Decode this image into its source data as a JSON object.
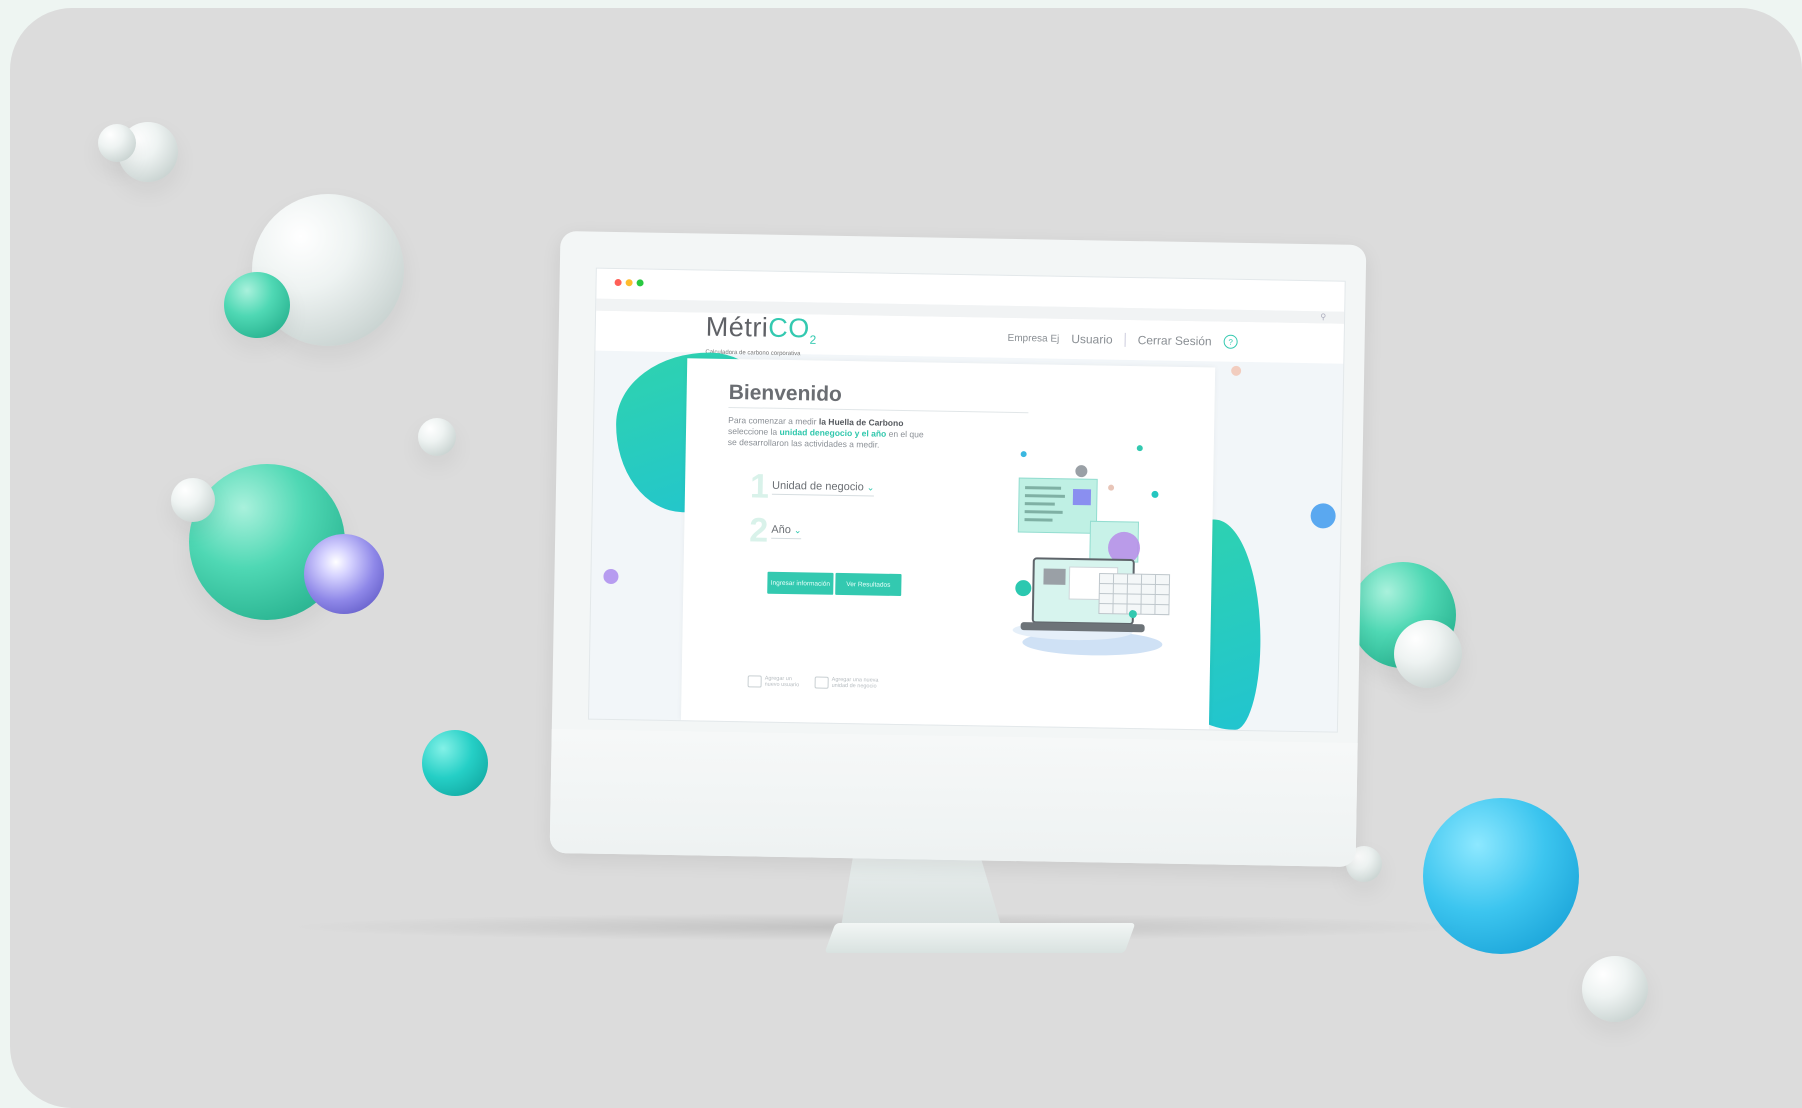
{
  "window": {
    "dot_colors": [
      "#ff5f57",
      "#febc2e",
      "#28c840"
    ],
    "search_icon": "search-icon"
  },
  "brand": {
    "logo_main": "Métri",
    "logo_co": "CO",
    "logo_sub2": "2",
    "tagline": "Calculadora de carbono corporativa"
  },
  "nav": {
    "company": "Empresa Ej",
    "user": "Usuario",
    "logout": "Cerrar Sesión",
    "help": "?"
  },
  "main": {
    "title": "Bienvenido",
    "intro_prefix": "Para comenzar a medir ",
    "intro_bold": "la Huella de Carbono",
    "intro_mid": " seleccione la ",
    "intro_hl1": "unidad denegocio",
    "intro_and": " y el ",
    "intro_hl2": "año",
    "intro_suffix": " en el que se desarrollaron las actividades a medir."
  },
  "steps": [
    {
      "number": "1",
      "label": "Unidad de negocio"
    },
    {
      "number": "2",
      "label": "Año"
    }
  ],
  "buttons": {
    "ingresar": "Ingresar información",
    "ver": "Ver Resultados"
  },
  "footer_links": [
    {
      "label": "Agregar un nuevo usuario"
    },
    {
      "label": "Agregar una nueva unidad de negocio"
    }
  ],
  "colors": {
    "accent": "#33c9b0",
    "text_dark": "#6a6d72"
  }
}
